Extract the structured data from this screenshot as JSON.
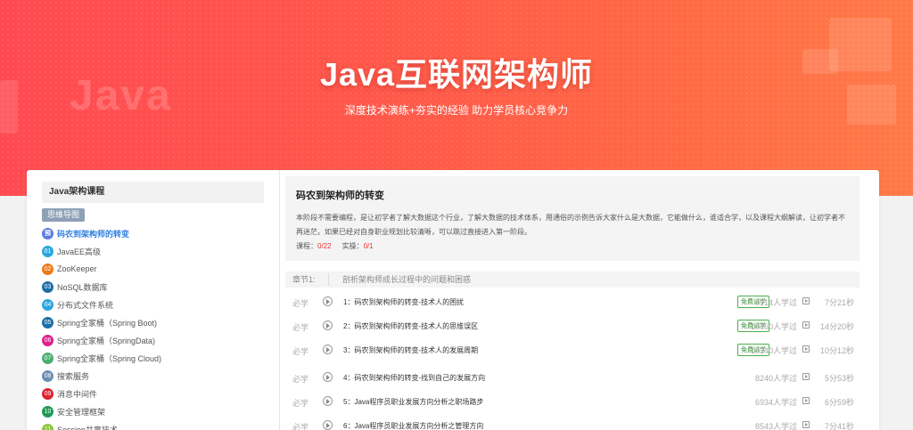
{
  "hero": {
    "title": "Java互联网架构师",
    "subtitle": "深度技术演练+夯实的经验 助力学员核心竞争力",
    "watermark": "Java",
    "background_color": "#ff5a4a"
  },
  "sidebar": {
    "heading": "Java架构课程",
    "mindmap_button": "思维导图",
    "courses": [
      {
        "num": "预",
        "label": "码农到架构师的转变",
        "color": "#5b7be0",
        "active": true
      },
      {
        "num": "01",
        "label": "JavaEE高级",
        "color": "#2aa7e0"
      },
      {
        "num": "02",
        "label": "ZooKeeper",
        "color": "#f07a17"
      },
      {
        "num": "03",
        "label": "NoSQL数据库",
        "color": "#1a6fa8"
      },
      {
        "num": "04",
        "label": "分布式文件系统",
        "color": "#2aa7e0"
      },
      {
        "num": "05",
        "label": "Spring全家桶（Spring Boot)",
        "color": "#1a6fa8"
      },
      {
        "num": "06",
        "label": "Spring全家桶（SpringData)",
        "color": "#e0208a"
      },
      {
        "num": "07",
        "label": "Spring全家桶（Spring Cloud)",
        "color": "#4caf70"
      },
      {
        "num": "08",
        "label": "搜索服务",
        "color": "#6a8fb5"
      },
      {
        "num": "09",
        "label": "消息中间件",
        "color": "#e02030"
      },
      {
        "num": "10",
        "label": "安全管理框架",
        "color": "#1e9a55"
      },
      {
        "num": "11",
        "label": "Session共享技术",
        "color": "#8cc63f"
      }
    ]
  },
  "intro": {
    "title": "码农到架构师的转变",
    "description": "本阶段不需要编程，是让初学者了解大数据这个行业，了解大数据的技术体系，用通俗的示例告诉大家什么是大数据，它能做什么，谁适合学，以及课程大纲解读，让初学者不再迷茫。如果已经对自身职业规划比较清晰，可以跳过直接进入第一阶段。",
    "course_label": "课程：",
    "course_value": "0/22",
    "practice_label": "实操：",
    "practice_value": "0/1"
  },
  "chapter": {
    "label": "章节1:",
    "title": "剖析架构师成长过程中的问题和困惑"
  },
  "lessons": [
    {
      "required": "必学",
      "title": "1：码农到架构师的转变-技术人的困扰",
      "trial": "免费试学",
      "learners": "9914人学过",
      "duration": "7分21秒"
    },
    {
      "required": "必学",
      "title": "2：码农到架构师的转变-技术人的思维误区",
      "trial": "免费试学",
      "learners": "10460人学过",
      "duration": "14分20秒"
    },
    {
      "required": "必学",
      "title": "3：码农到架构师的转变-技术人的发展周期",
      "trial": "免费试学",
      "learners": "10340人学过",
      "duration": "10分12秒"
    },
    {
      "required": "必学",
      "title": "4：码农到架构师的转变-找到自己的发展方向",
      "trial": "",
      "learners": "8240人学过",
      "duration": "5分53秒"
    },
    {
      "required": "必学",
      "title": "5：Java程序员职业发展方向分析之职场路步",
      "trial": "",
      "learners": "6934人学过",
      "duration": "6分59秒"
    },
    {
      "required": "必学",
      "title": "6：Java程序员职业发展方向分析之管理方向",
      "trial": "",
      "learners": "8543人学过",
      "duration": "7分41秒"
    }
  ]
}
